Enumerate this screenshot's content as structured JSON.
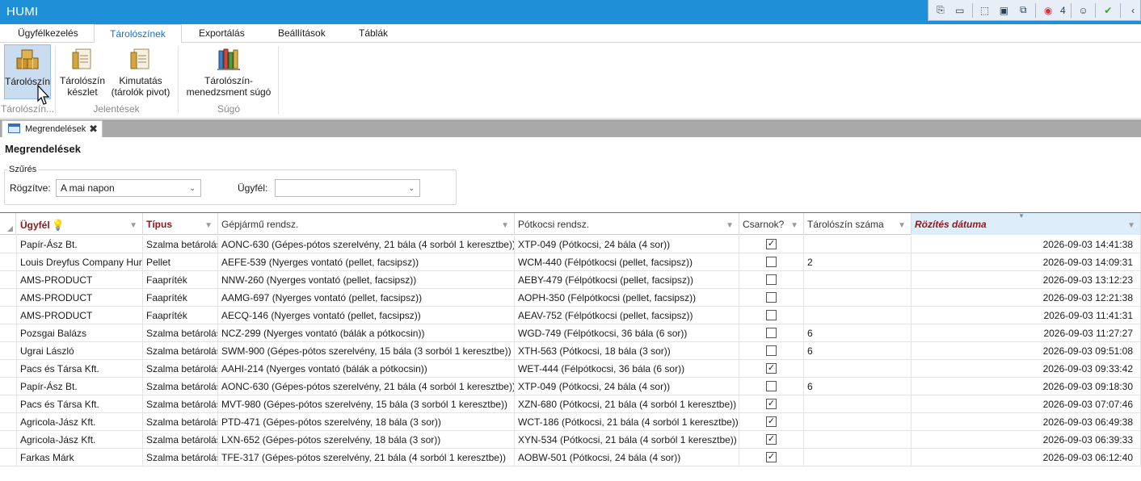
{
  "app": {
    "title": "HUMI",
    "tray_count": "4"
  },
  "ribbon_tabs": [
    "Ügyfélkezelés",
    "Tárolószínek",
    "Exportálás",
    "Beállítások",
    "Táblák"
  ],
  "ribbon": {
    "btn_taroloszin": "Tárolószín",
    "btn_keszlet_l1": "Tárolószín",
    "btn_keszlet_l2": "készlet",
    "btn_kimutatas_l1": "Kimutatás",
    "btn_kimutatas_l2": "(tárolók pivot)",
    "btn_sugo_l1": "Tárolószín-",
    "btn_sugo_l2": "menedzsment súgó",
    "group1": "Tárolószín...",
    "group2": "Jelentések",
    "group3": "Súgó"
  },
  "doc_tab": {
    "label": "Megrendelések",
    "close": "✖"
  },
  "page": {
    "heading": "Megrendelések",
    "filter_title": "Szűrés",
    "recorded_label": "Rögzítve:",
    "recorded_value": "A mai napon",
    "client_label": "Ügyfél:",
    "client_value": ""
  },
  "grid": {
    "columns": [
      "Ügyfél",
      "Típus",
      "Gépjármű rendsz.",
      "Pótkocsi rendsz.",
      "Csarnok?",
      "Tárolószín száma",
      "Rözítés dátuma"
    ],
    "rows": [
      {
        "client": "Papír-Ász Bt.",
        "type": "Szalma betárolás",
        "vehicle": "AONC-630   (Gépes-pótos szerelvény, 21 bála (4 sorból 1 keresztbe))",
        "trailer": "XTP-049   (Pótkocsi, 24 bála (4 sor))",
        "hall": true,
        "storage": "",
        "date": "2026-09-03 14:41:38"
      },
      {
        "client": "Louis Dreyfus Company Hun",
        "type": "Pellet",
        "vehicle": "AEFE-539   (Nyerges vontató (pellet, facsipsz))",
        "trailer": "WCM-440   (Félpótkocsi (pellet, facsipsz))",
        "hall": false,
        "storage": "2",
        "date": "2026-09-03 14:09:31"
      },
      {
        "client": "AMS-PRODUCT",
        "type": "Faapríték",
        "vehicle": "NNW-260   (Nyerges vontató (pellet, facsipsz))",
        "trailer": "AEBY-479   (Félpótkocsi (pellet, facsipsz))",
        "hall": false,
        "storage": "",
        "date": "2026-09-03 13:12:23"
      },
      {
        "client": "AMS-PRODUCT",
        "type": "Faapríték",
        "vehicle": "AAMG-697   (Nyerges vontató (pellet, facsipsz))",
        "trailer": "AOPH-350   (Félpótkocsi (pellet, facsipsz))",
        "hall": false,
        "storage": "",
        "date": "2026-09-03 12:21:38"
      },
      {
        "client": "AMS-PRODUCT",
        "type": "Faapríték",
        "vehicle": "AECQ-146   (Nyerges vontató (pellet, facsipsz))",
        "trailer": "AEAV-752   (Félpótkocsi (pellet, facsipsz))",
        "hall": false,
        "storage": "",
        "date": "2026-09-03 11:41:31"
      },
      {
        "client": "Pozsgai Balázs",
        "type": "Szalma betárolás",
        "vehicle": "NCZ-299   (Nyerges vontató (bálák a pótkocsin))",
        "trailer": "WGD-749   (Félpótkocsi, 36 bála (6 sor))",
        "hall": false,
        "storage": "6",
        "date": "2026-09-03 11:27:27"
      },
      {
        "client": "Ugrai László",
        "type": "Szalma betárolás",
        "vehicle": "SWM-900   (Gépes-pótos szerelvény, 15 bála (3 sorból 1 keresztbe))",
        "trailer": "XTH-563   (Pótkocsi, 18 bála (3 sor))",
        "hall": false,
        "storage": "6",
        "date": "2026-09-03 09:51:08"
      },
      {
        "client": "Pacs és Társa Kft.",
        "type": "Szalma betárolás",
        "vehicle": "AAHI-214   (Nyerges vontató (bálák a pótkocsin))",
        "trailer": "WET-444   (Félpótkocsi, 36 bála (6 sor))",
        "hall": true,
        "storage": "",
        "date": "2026-09-03 09:33:42"
      },
      {
        "client": "Papír-Ász Bt.",
        "type": "Szalma betárolás",
        "vehicle": "AONC-630   (Gépes-pótos szerelvény, 21 bála (4 sorból 1 keresztbe))",
        "trailer": "XTP-049   (Pótkocsi, 24 bála (4 sor))",
        "hall": false,
        "storage": "6",
        "date": "2026-09-03 09:18:30"
      },
      {
        "client": "Pacs és Társa Kft.",
        "type": "Szalma betárolás",
        "vehicle": "MVT-980   (Gépes-pótos szerelvény, 15 bála (3 sorból 1 keresztbe))",
        "trailer": "XZN-680   (Pótkocsi, 21 bála (4 sorból 1 keresztbe))",
        "hall": true,
        "storage": "",
        "date": "2026-09-03 07:07:46"
      },
      {
        "client": "Agricola-Jász Kft.",
        "type": "Szalma betárolás",
        "vehicle": "PTD-471   (Gépes-pótos szerelvény, 18 bála (3 sor))",
        "trailer": "WCT-186   (Pótkocsi, 21 bála (4 sorból 1 keresztbe))",
        "hall": true,
        "storage": "",
        "date": "2026-09-03 06:49:38"
      },
      {
        "client": "Agricola-Jász Kft.",
        "type": "Szalma betárolás",
        "vehicle": "LXN-652   (Gépes-pótos szerelvény, 18 bála (3 sor))",
        "trailer": "XYN-534   (Pótkocsi, 21 bála (4 sorból 1 keresztbe))",
        "hall": true,
        "storage": "",
        "date": "2026-09-03 06:39:33"
      },
      {
        "client": "Farkas Márk",
        "type": "Szalma betárolás",
        "vehicle": "TFE-317   (Gépes-pótos szerelvény, 21 bála (4 sorból 1 keresztbe))",
        "trailer": "AOBW-501   (Pótkocsi, 24 bála (4 sor))",
        "hall": true,
        "storage": "",
        "date": "2026-09-03 06:12:40"
      }
    ]
  }
}
